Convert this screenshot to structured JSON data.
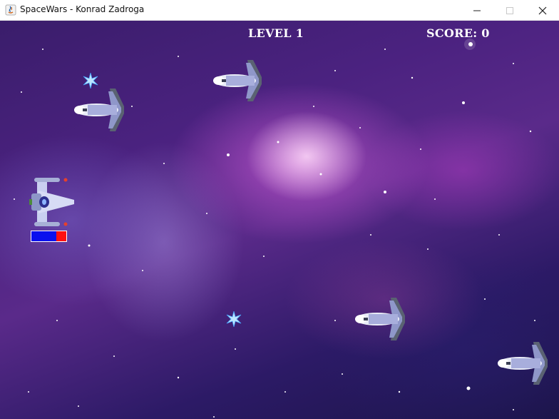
{
  "window": {
    "title": "SpaceWars - Konrad Zadroga",
    "icon": "java-icon",
    "controls": [
      "minimize-icon",
      "maximize-icon",
      "close-icon"
    ]
  },
  "hud": {
    "level": "LEVEL 1",
    "score": "SCORE: 0"
  },
  "player": {
    "health_fraction": 0.72,
    "health_color": "#0a10ee",
    "damage_color": "#ff1010"
  },
  "enemies": {
    "count": 4,
    "type": "space-shuttle"
  },
  "colors": {
    "background_primary": "#4b2280",
    "hud_text": "#ffffff"
  }
}
